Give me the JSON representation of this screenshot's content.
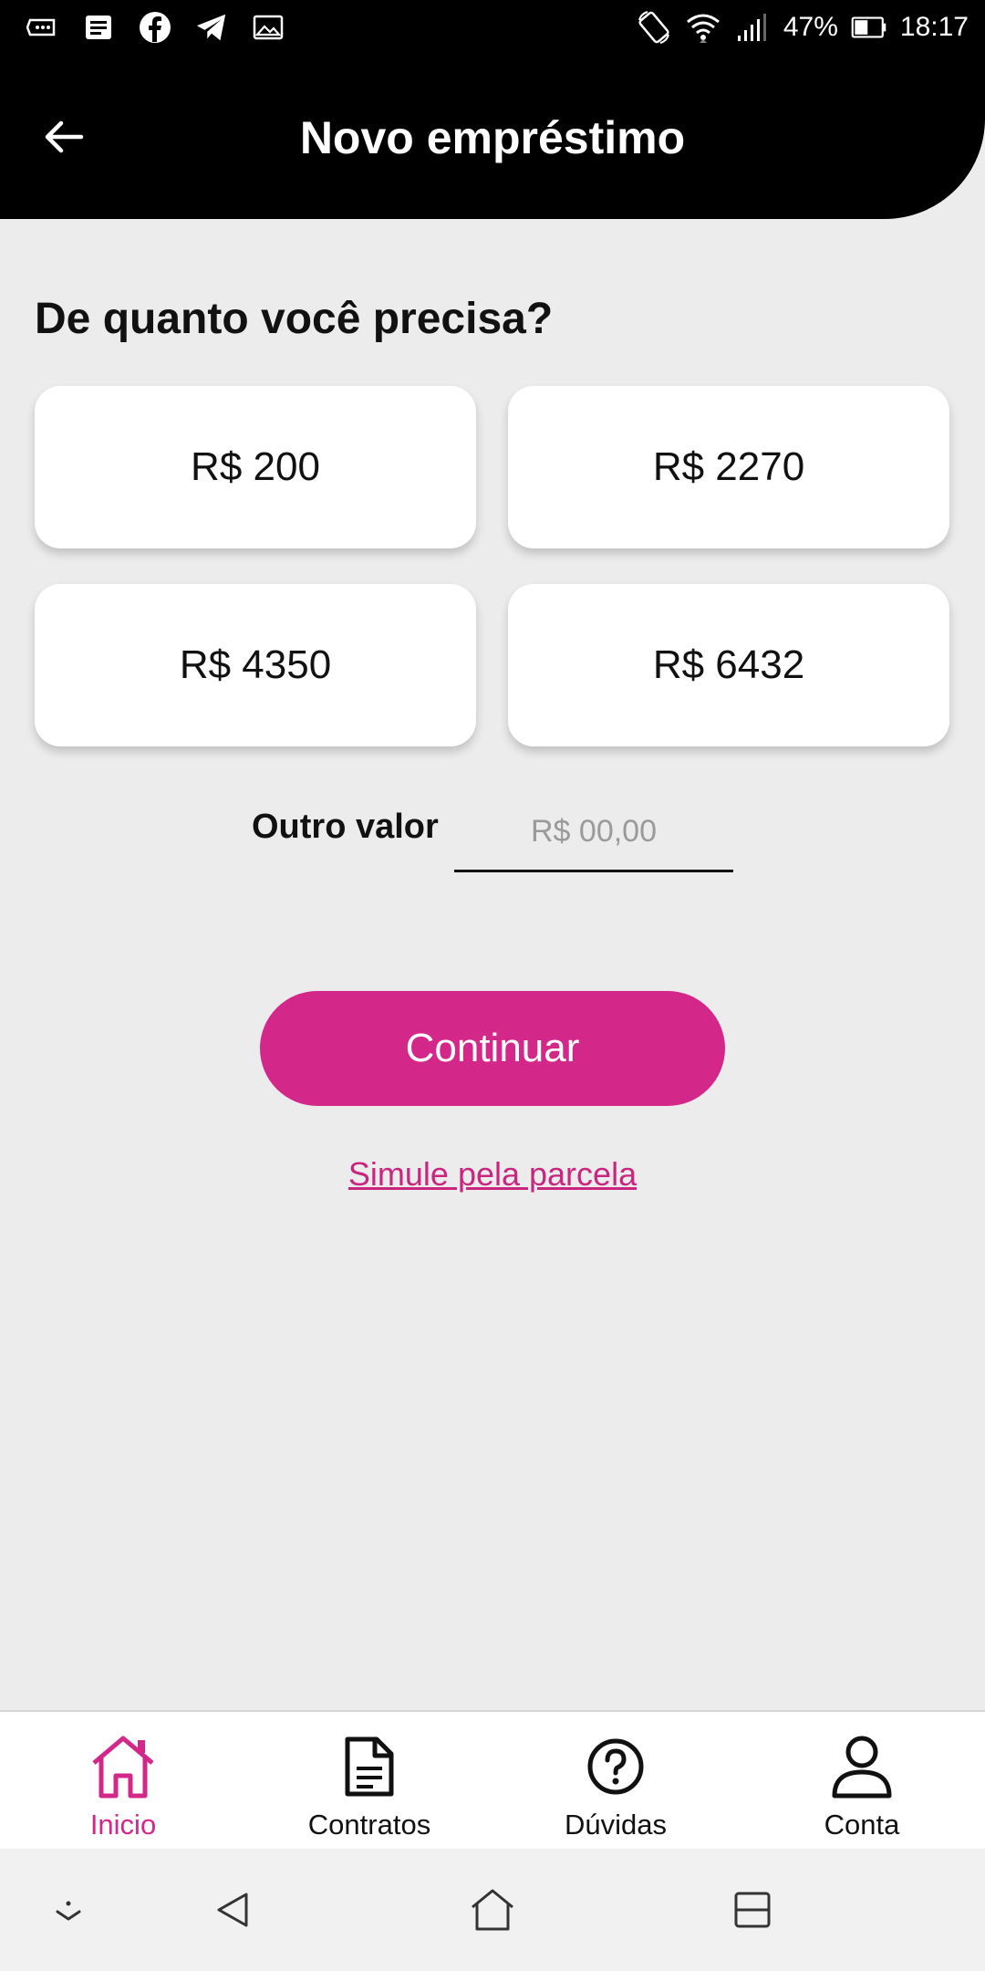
{
  "status_bar": {
    "battery": "47%",
    "time": "18:17",
    "left_icons": [
      "voicemail-icon",
      "message-icon",
      "facebook-icon",
      "telegram-icon",
      "image-icon"
    ],
    "right_icons": [
      "rotate-icon",
      "wifi-icon",
      "signal-icon",
      "battery-icon"
    ]
  },
  "header": {
    "title": "Novo empréstimo",
    "back_icon": "back-arrow-icon"
  },
  "main": {
    "question": "De quanto você precisa?",
    "amounts": [
      "R$ 200",
      "R$ 2270",
      "R$ 4350",
      "R$ 6432"
    ],
    "other_value_label": "Outro valor",
    "other_value_placeholder": "R$ 00,00",
    "other_value_current": "",
    "continue_label": "Continuar",
    "simulate_link": "Simule pela parcela"
  },
  "bottom_nav": {
    "items": [
      {
        "label": "Inicio",
        "icon": "home-icon",
        "active": true
      },
      {
        "label": "Contratos",
        "icon": "document-icon",
        "active": false
      },
      {
        "label": "Dúvidas",
        "icon": "help-icon",
        "active": false
      },
      {
        "label": "Conta",
        "icon": "user-icon",
        "active": false
      }
    ]
  },
  "system_nav": {
    "icons": [
      "hide-keyboard-icon",
      "back-triangle-icon",
      "home-outline-icon",
      "recents-icon"
    ]
  },
  "colors": {
    "accent": "#d4278a",
    "header_bg": "#000000",
    "page_bg": "#ececec"
  }
}
